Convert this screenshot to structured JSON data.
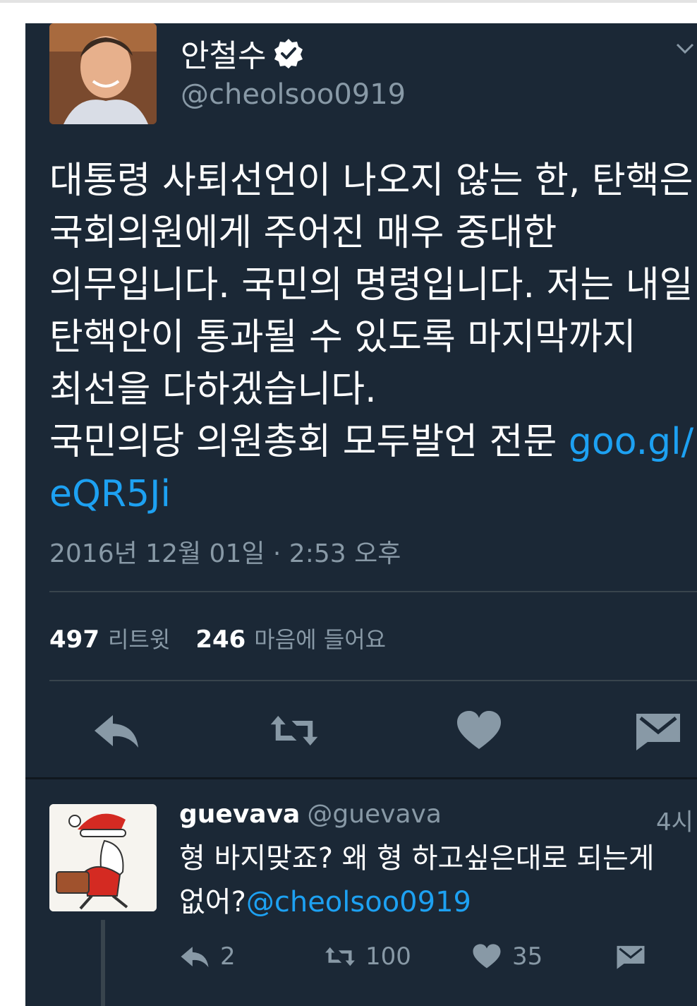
{
  "tweet": {
    "display_name": "안철수",
    "handle": "@cheolsoo0919",
    "text_lines": [
      "대통령 사퇴선언이 나오지 않는 한, 탄핵은",
      "국회의원에게 주어진 매우 중대한",
      "의무입니다. 국민의 명령입니다. 저는 내일",
      "탄핵안이 통과될 수 있도록 마지막까지",
      "최선을 다하겠습니다."
    ],
    "last_line_text": "국민의당 의원총회 모두발언 전문 ",
    "link_part1": "goo.gl/",
    "link_part2": "eQR5Ji",
    "timestamp": "2016년 12월 01일 · 2:53 오후",
    "retweet_count": "497",
    "retweet_label": "리트윗",
    "like_count": "246",
    "like_label": "마음에 들어요"
  },
  "actions": [
    "reply-icon",
    "retweet-icon",
    "heart-icon",
    "message-icon"
  ],
  "reply": {
    "name": "guevava",
    "handle": "@guevava",
    "time": "4시",
    "text_line1": "형 바지맞죠? 왜 형 하고싶은대로 되는게",
    "text_line2_prefix": "없어?",
    "mention": "@cheolsoo0919",
    "reply_count": "2",
    "retweet_count": "100",
    "like_count": "35"
  },
  "colors": {
    "background": "#1b2836",
    "link": "#1da1f2",
    "secondary_text": "#8899a6",
    "icon": "#8899a6"
  }
}
